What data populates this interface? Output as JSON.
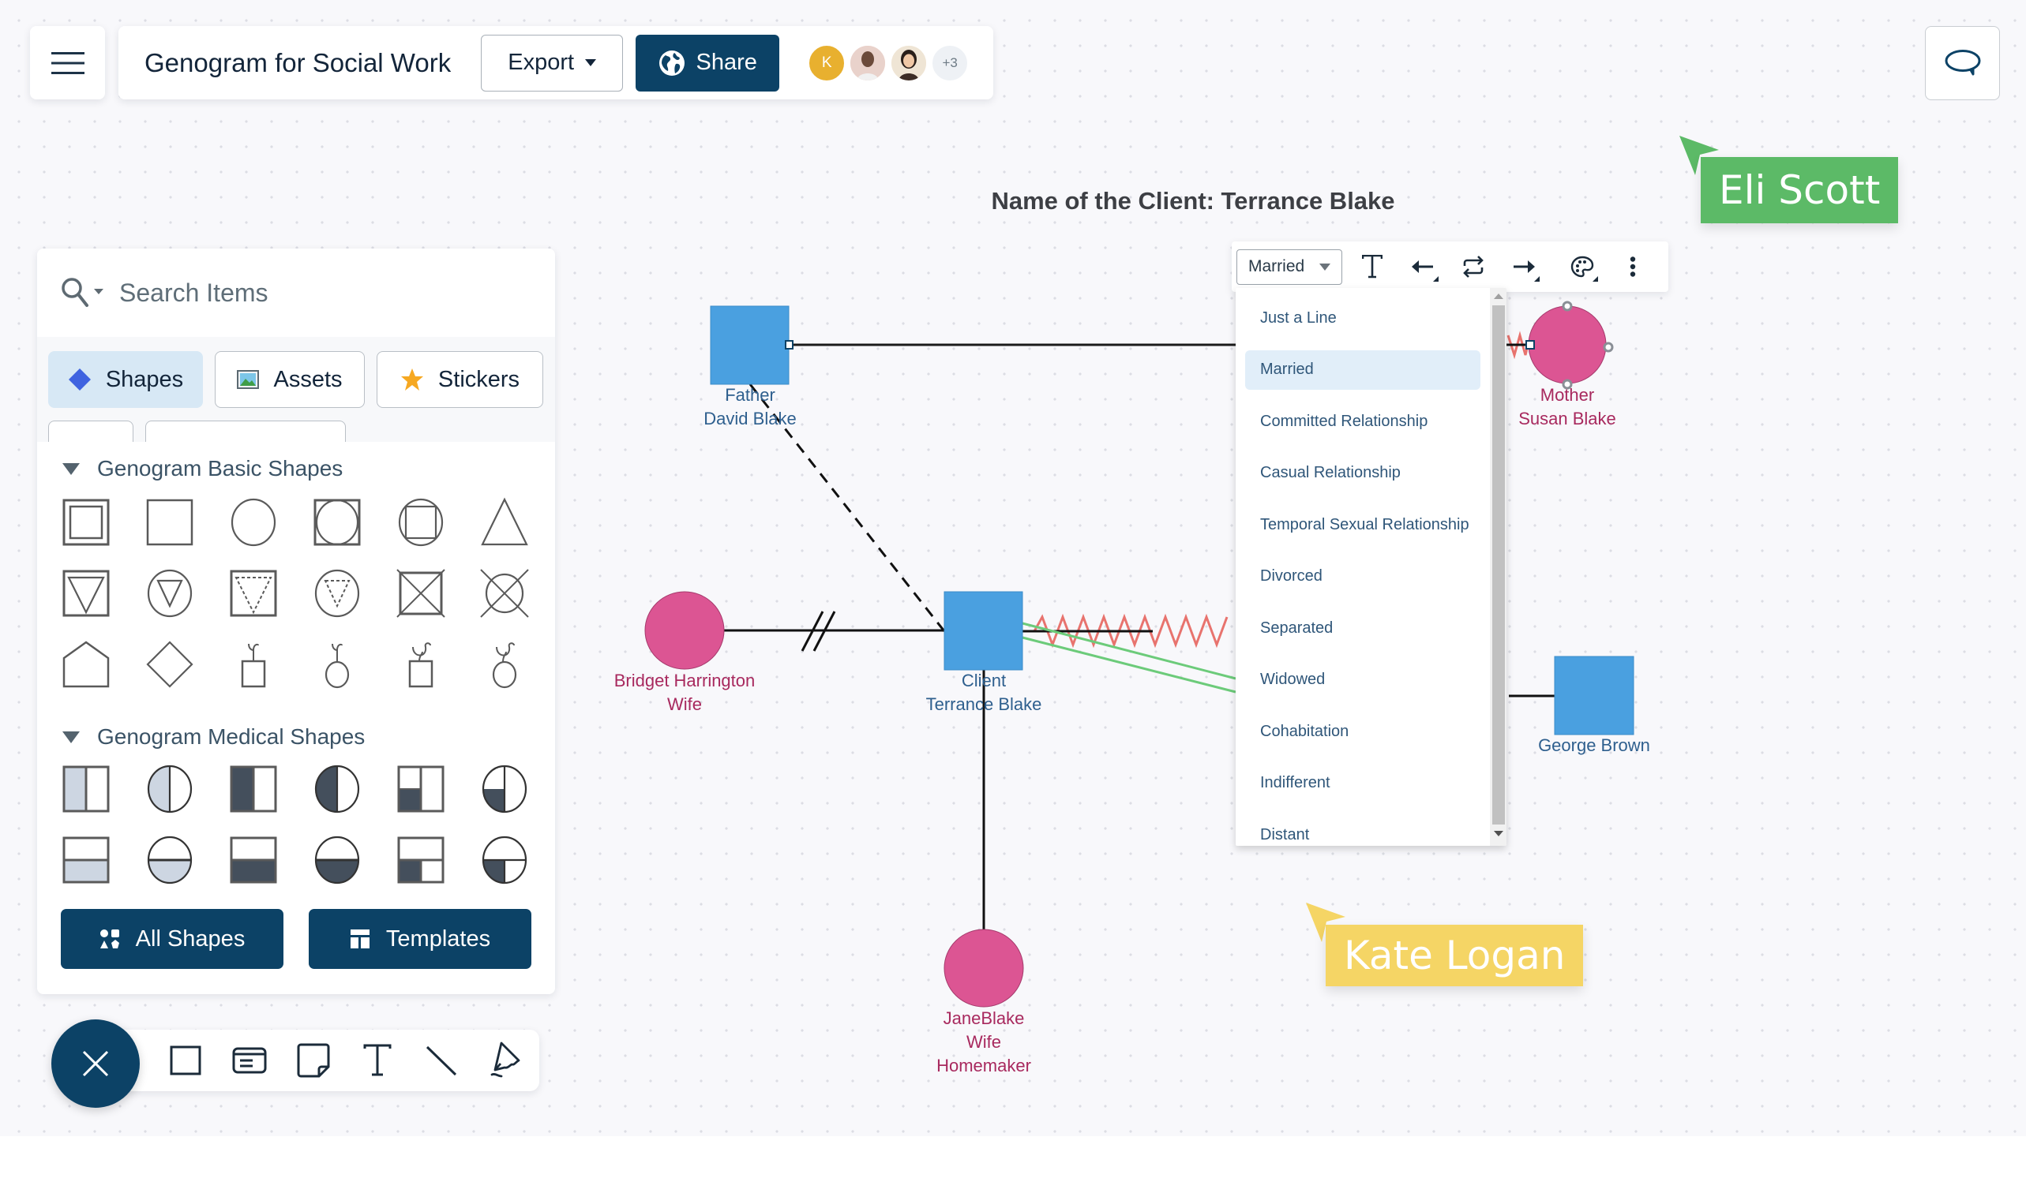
{
  "header": {
    "menu_icon": "hamburger-icon",
    "document_title": "Genogram for Social Work",
    "export_label": "Export",
    "share_label": "Share",
    "collaborators": [
      {
        "type": "initial",
        "text": "K",
        "color": "#e8b02f"
      },
      {
        "type": "photo",
        "text": "",
        "color": "#f2c9bd"
      },
      {
        "type": "photo",
        "text": "",
        "color": "#f3e6cf"
      }
    ],
    "more_collaborators": "+3",
    "comment_icon": "comment-bubble-icon"
  },
  "left_panel": {
    "search_placeholder": "Search Items",
    "tabs": [
      {
        "label": "Shapes",
        "icon": "diamond-icon",
        "active": true
      },
      {
        "label": "Assets",
        "icon": "image-icon",
        "active": false
      },
      {
        "label": "Stickers",
        "icon": "star-icon",
        "active": false
      }
    ],
    "sections": [
      {
        "title": "Genogram Basic Shapes",
        "expanded": true,
        "shapes": [
          "male-double-square",
          "male-square",
          "female-circle",
          "circle-in-square",
          "square-in-circle",
          "unknown-triangle",
          "pregnancy-in-square",
          "pregnancy-in-circle",
          "miscarriage-square",
          "miscarriage-circle",
          "deceased-male",
          "deceased-female",
          "pet-house",
          "diamond",
          "male-with-sprout",
          "female-with-sprout",
          "male-with-bird",
          "female-with-bird"
        ]
      },
      {
        "title": "Genogram Medical Shapes",
        "expanded": true,
        "shapes": [
          "male-left-half-light",
          "female-left-half-light",
          "male-left-half-dark",
          "female-left-half-dark",
          "male-bottom-left-quarter",
          "female-bottom-left-quarter",
          "male-bottom-half-light",
          "female-bottom-half-light",
          "male-bottom-half-dark",
          "female-bottom-half-dark",
          "male-bottom-left-quarter-b",
          "female-bottom-left-quarter-b"
        ]
      }
    ],
    "all_shapes_label": "All Shapes",
    "templates_label": "Templates"
  },
  "bottom_toolbar": {
    "close_icon": "close-icon",
    "tools": [
      "rectangle-tool-icon",
      "card-tool-icon",
      "sticky-note-tool-icon",
      "text-tool-icon",
      "line-tool-icon",
      "pen-tool-icon"
    ]
  },
  "diagram": {
    "title": "Name of the Client: Terrance Blake",
    "people": [
      {
        "id": "father",
        "gender": "male",
        "lines": [
          "Father",
          "David Blake"
        ]
      },
      {
        "id": "mother",
        "gender": "female",
        "lines": [
          "Mother",
          "Susan Blake"
        ],
        "selected": true
      },
      {
        "id": "client",
        "gender": "male",
        "lines": [
          "Client",
          "Terrance Blake"
        ]
      },
      {
        "id": "bridget",
        "gender": "female",
        "lines": [
          "Bridget Harrington",
          "Wife"
        ]
      },
      {
        "id": "jane",
        "gender": "female",
        "lines": [
          "JaneBlake",
          "Wife",
          "Homemaker"
        ]
      },
      {
        "id": "george",
        "gender": "male",
        "lines": [
          "George Brown"
        ]
      }
    ],
    "relationships": [
      {
        "from": "father",
        "to": "mother",
        "type": "Married",
        "selected": true
      },
      {
        "from": "father",
        "to": "client",
        "type": "dashed"
      },
      {
        "from": "bridget",
        "to": "client",
        "type": "Divorced"
      },
      {
        "from": "client",
        "to": "mother",
        "type": "hostile-zigzag"
      },
      {
        "from": "client",
        "to": "george",
        "type": "green-double-line"
      },
      {
        "from": "client",
        "to": "jane",
        "type": "line"
      }
    ],
    "colors": {
      "male_fill": "#4aa0e0",
      "female_fill": "#dc5593",
      "hostile": "#e8736e",
      "close": "#6ccb7a"
    }
  },
  "context_toolbar": {
    "relationship_value": "Married",
    "buttons": [
      "text-icon",
      "arrow-left-icon",
      "swap-icon",
      "arrow-right-icon",
      "palette-icon",
      "more-vertical-icon"
    ]
  },
  "relationship_dropdown": {
    "options": [
      "Just a Line",
      "Married",
      "Committed Relationship",
      "Casual Relationship",
      "Temporal Sexual Relationship",
      "Divorced",
      "Separated",
      "Widowed",
      "Cohabitation",
      "Indifferent",
      "Distant"
    ],
    "selected": "Married"
  },
  "cursors": [
    {
      "name": "Eli Scott",
      "color": "#5cba67"
    },
    {
      "name": "Kate Logan",
      "color": "#f5d565"
    }
  ]
}
